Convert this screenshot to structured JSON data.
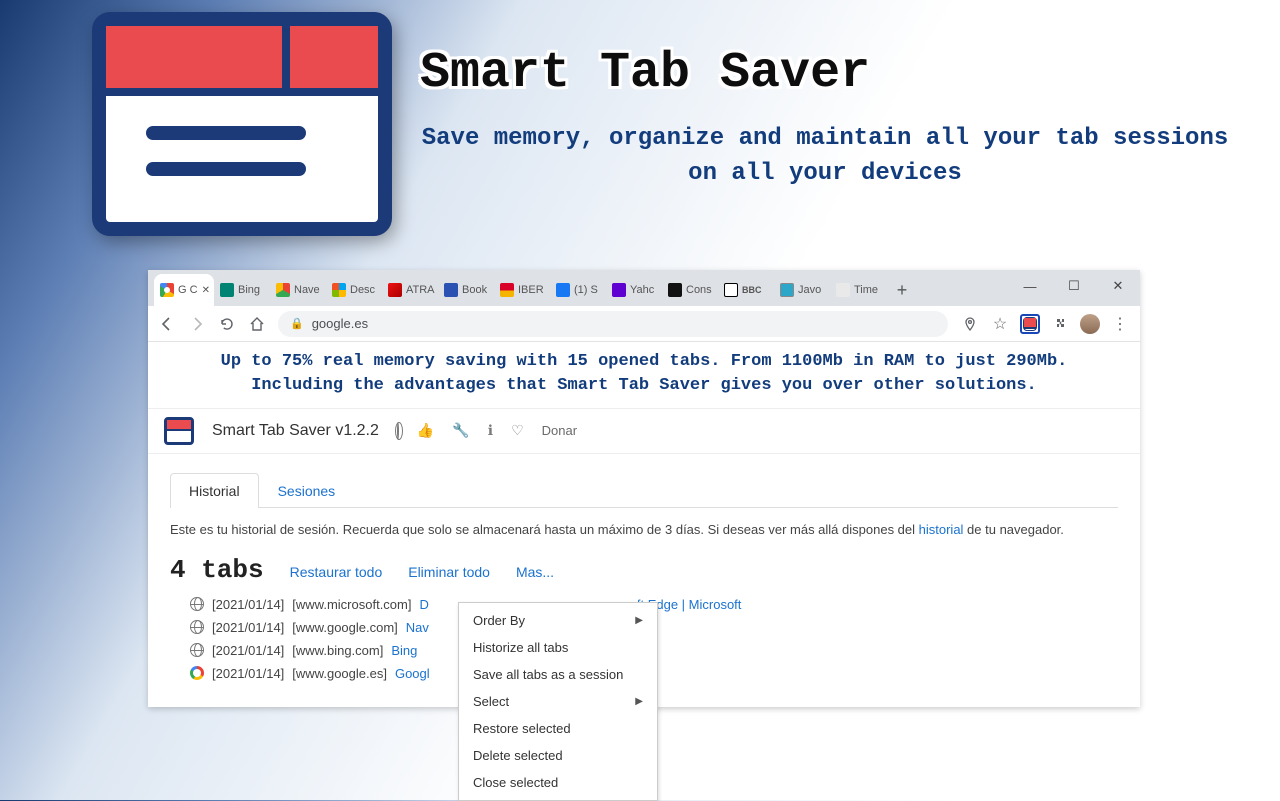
{
  "hero": {
    "title": "Smart Tab Saver",
    "subtitle": "Save memory, organize and maintain all your tab sessions on all your devices"
  },
  "browser": {
    "tabs": [
      {
        "label": "G C",
        "active": true
      },
      {
        "label": "Bing"
      },
      {
        "label": "Nave"
      },
      {
        "label": "Desc"
      },
      {
        "label": "ATRA"
      },
      {
        "label": "Book"
      },
      {
        "label": "IBER"
      },
      {
        "label": "(1) S"
      },
      {
        "label": "Yahc"
      },
      {
        "label": "Cons"
      },
      {
        "label": "BBC"
      },
      {
        "label": "Javo"
      },
      {
        "label": "Time"
      }
    ],
    "url": "google.es"
  },
  "memory_line": "Up to 75% real memory saving with 15 opened tabs. From 1100Mb in RAM to just 290Mb.\nIncluding the advantages that Smart Tab Saver gives you over other solutions.",
  "popup": {
    "title": "Smart Tab Saver v1.2.2",
    "donate": "Donar"
  },
  "nav": {
    "history": "Historial",
    "sessions": "Sesiones"
  },
  "desc_pre": "Este es tu historial de sesión. Recuerda que solo se almacenará hasta un máximo de 3 días. Si deseas ver más allá dispones del ",
  "desc_link": "historial",
  "desc_post": " de tu navegador.",
  "counter": "4 tabs",
  "actions": {
    "restore": "Restaurar todo",
    "delete": "Eliminar todo",
    "more": "Mas..."
  },
  "history": [
    {
      "date": "[2021/01/14]",
      "domain": "[www.microsoft.com]",
      "title_pre": "D",
      "title_post": "ft Edge | Microsoft"
    },
    {
      "date": "[2021/01/14]",
      "domain": "[www.google.com]",
      "title_pre": "Nav",
      "title_post": ""
    },
    {
      "date": "[2021/01/14]",
      "domain": "[www.bing.com]",
      "title_pre": "Bing",
      "title_post": ""
    },
    {
      "date": "[2021/01/14]",
      "domain": "[www.google.es]",
      "title_pre": "Googl",
      "title_post": ""
    }
  ],
  "menu": {
    "orderby": "Order By",
    "hist": "Historize all tabs",
    "savesess": "Save all tabs as a session",
    "select": "Select",
    "restoresel": "Restore selected",
    "deletesel": "Delete selected",
    "closesel": "Close selected"
  }
}
